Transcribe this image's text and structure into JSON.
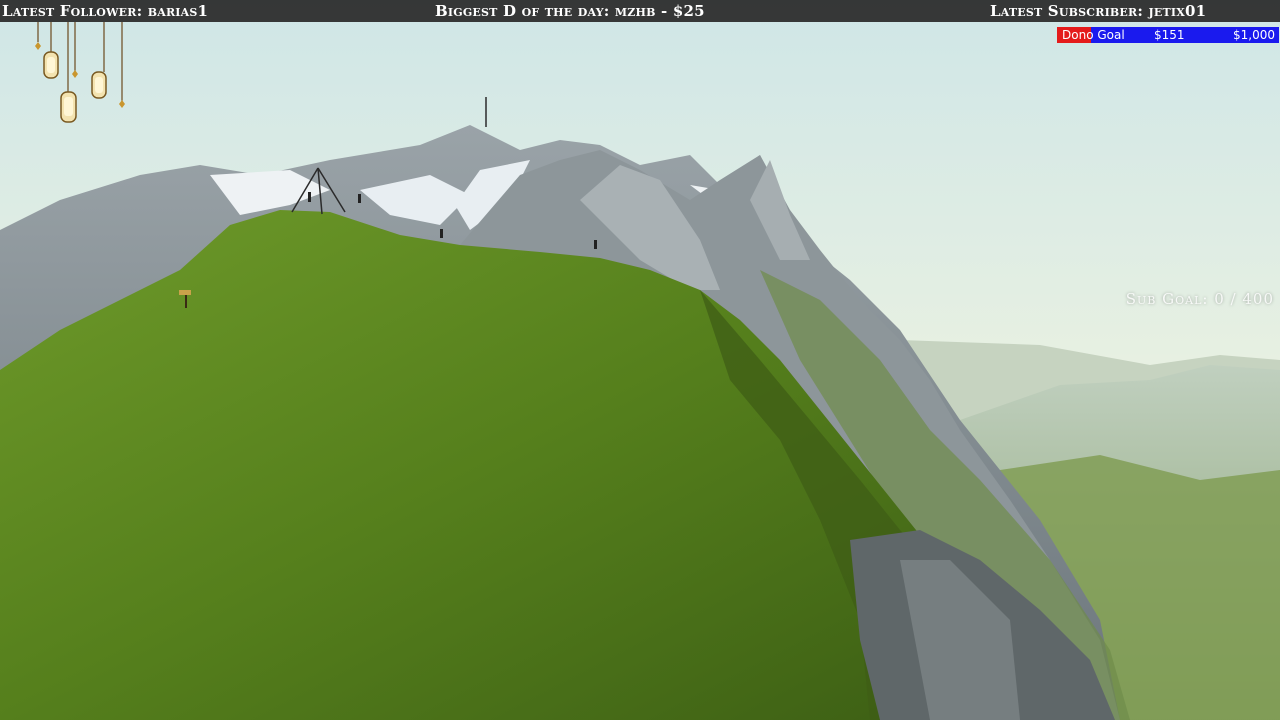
{
  "topbar": {
    "latest_follower": "Latest Follower: barias1",
    "biggest_donation": "Biggest D of the day: mzhb - $25",
    "latest_subscriber": "Latest Subscriber: jetix01"
  },
  "dono_goal": {
    "label": "Dono Goal",
    "current": "$151",
    "target": "$1,000",
    "progress_fraction": 0.151,
    "fill_color": "#e41b1b",
    "bar_color": "#1a1aee"
  },
  "sub_goal": {
    "text": "Sub Goal: 0 / 400"
  },
  "decor": {
    "icon": "hanging-lanterns-icon"
  }
}
